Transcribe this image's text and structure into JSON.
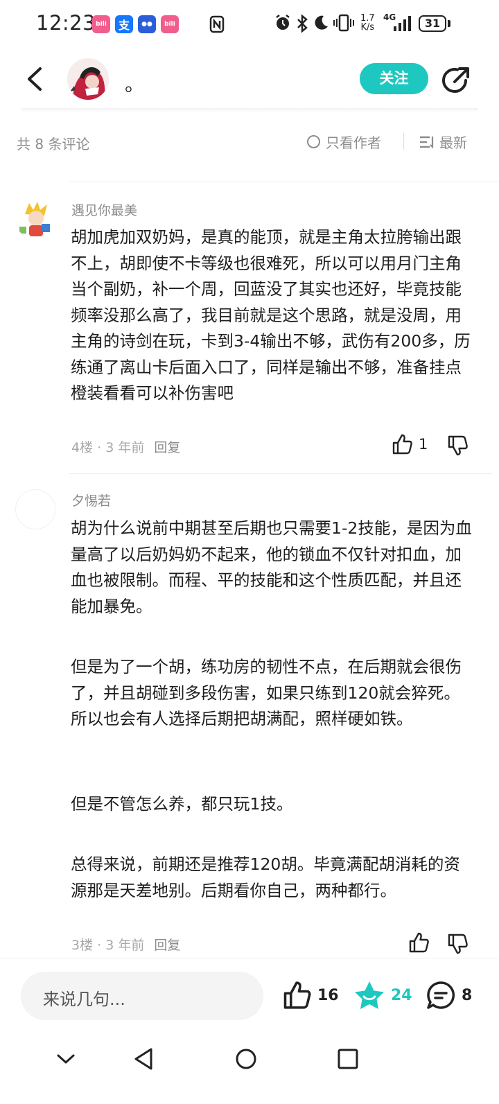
{
  "status_bar": {
    "time": "12:23",
    "app_icons": [
      "bilibili-icon",
      "alipay-icon",
      "app-icon",
      "bilibili-icon"
    ],
    "net_speed_top": "1.7",
    "net_speed_bottom": "K/s",
    "network": "4G",
    "battery": "31"
  },
  "header": {
    "author_name": "。",
    "follow_label": "关注"
  },
  "comment_bar": {
    "count_text": "共 8 条评论",
    "only_author": "只看作者",
    "sort_label": "最新"
  },
  "comments": [
    {
      "user": "遇见你最美",
      "paragraphs": [
        "胡加虎加双奶妈，是真的能顶，就是主角太拉胯输出跟不上，胡即使不卡等级也很难死，所以可以用月门主角当个副奶，补一个周，回蓝没了其实也还好，毕竟技能频率没那么高了，我目前就是这个思路，就是没周，用主角的诗剑在玩，卡到3-4输出不够，武伤有200多，历练通了离山卡后面入口了，同样是输出不够，准备挂点橙装看看可以补伤害吧"
      ],
      "floor": "4楼",
      "time": "3 年前",
      "reply": "回复",
      "likes": "1"
    },
    {
      "user": "夕惕若",
      "paragraphs": [
        "胡为什么说前中期甚至后期也只需要1-2技能，是因为血量高了以后奶妈奶不起来，他的锁血不仅针对扣血，加血也被限制。而程、平的技能和这个性质匹配，并且还能加暴免。",
        "但是为了一个胡，练功房的韧性不点，在后期就会很伤了，并且胡碰到多段伤害，如果只练到120就会猝死。所以也会有人选择后期把胡满配，照样硬如铁。",
        "但是不管怎么养，都只玩1技。",
        "总得来说，前期还是推荐120胡。毕竟满配胡消耗的资源那是天差地别。后期看你自己，两种都行。"
      ],
      "floor": "3楼",
      "time": "3 年前",
      "reply": "回复",
      "likes": ""
    }
  ],
  "bottom_bar": {
    "input_placeholder": "来说几句...",
    "likes": "16",
    "favorites": "24",
    "comments": "8"
  },
  "colors": {
    "accent": "#1ec8c0",
    "muted": "#8c8c8c"
  }
}
